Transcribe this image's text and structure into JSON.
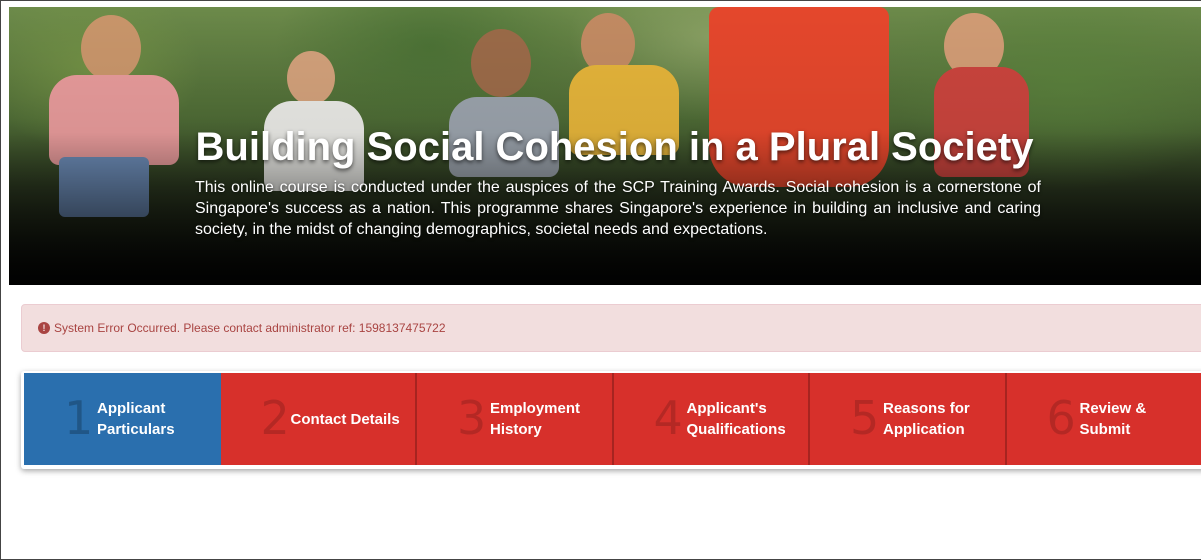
{
  "hero": {
    "title": "Building Social Cohesion in a Plural Society",
    "description": "This online course is conducted under the auspices of the SCP Training Awards. Social cohesion is a cornerstone of Singapore's success as a nation. This programme shares Singapore's experience in building an inclusive and caring society, in the midst of changing demographics, societal needs and expectations."
  },
  "alert": {
    "icon": "exclamation-circle-icon",
    "message": "System Error Occurred. Please contact administrator ref: 1598137475722",
    "color": "#a94442",
    "background": "#f2dede"
  },
  "stepper": {
    "active_color": "#2a6fae",
    "inactive_color": "#d7302b",
    "steps": [
      {
        "number": "1",
        "line1": "Applicant",
        "line2": "Particulars",
        "active": true
      },
      {
        "number": "2",
        "line1": "Contact Details",
        "line2": "",
        "active": false
      },
      {
        "number": "3",
        "line1": "Employment",
        "line2": "History",
        "active": false
      },
      {
        "number": "4",
        "line1": "Applicant's",
        "line2": "Qualifications",
        "active": false
      },
      {
        "number": "5",
        "line1": "Reasons for",
        "line2": "Application",
        "active": false
      },
      {
        "number": "6",
        "line1": "Review &",
        "line2": "Submit",
        "active": false
      }
    ]
  }
}
